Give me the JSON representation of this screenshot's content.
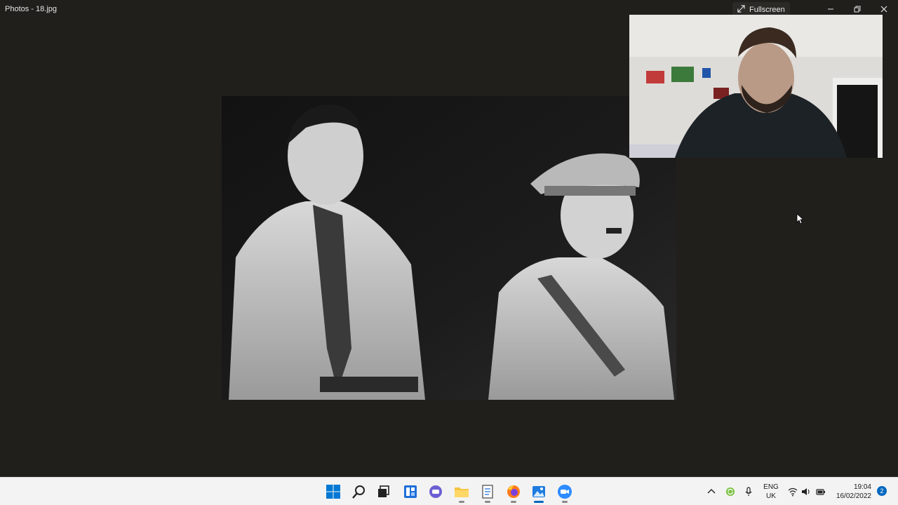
{
  "window": {
    "title": "Photos - 18.jpg",
    "fullscreen_label": "Fullscreen",
    "controls": [
      "minimize-icon",
      "restore-icon",
      "close-icon"
    ]
  },
  "viewer": {
    "image": "black-and-white-photo",
    "webcam_overlay": "webcam-feed"
  },
  "taskbar": {
    "apps": [
      {
        "name": "start",
        "icon": "windows-logo-icon"
      },
      {
        "name": "search",
        "icon": "search-icon"
      },
      {
        "name": "task-view",
        "icon": "task-view-icon"
      },
      {
        "name": "widgets",
        "icon": "widgets-icon"
      },
      {
        "name": "chat",
        "icon": "teams-chat-icon"
      },
      {
        "name": "file-explorer",
        "icon": "folder-icon",
        "running": true
      },
      {
        "name": "notepad",
        "icon": "notepad-icon",
        "running": true
      },
      {
        "name": "firefox",
        "icon": "firefox-icon",
        "running": true
      },
      {
        "name": "photos",
        "icon": "photos-icon",
        "running": true,
        "active": true
      },
      {
        "name": "zoom",
        "icon": "zoom-icon",
        "running": true
      }
    ],
    "tray": {
      "icons": [
        "chevron-up-icon",
        "sync-icon",
        "microphone-icon",
        "wifi-icon",
        "volume-icon",
        "battery-icon"
      ],
      "lang_line1": "ENG",
      "lang_line2": "UK",
      "time": "19:04",
      "date": "16/02/2022",
      "notifications": "2"
    }
  },
  "colors": {
    "background": "#201f1c",
    "taskbar": "#f3f3f3",
    "accent": "#0067c0"
  }
}
